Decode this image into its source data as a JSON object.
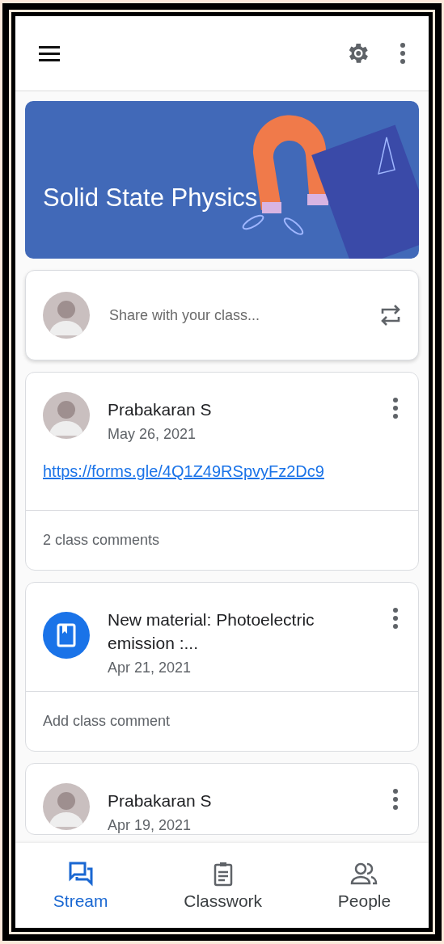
{
  "class_banner": {
    "title": "Solid State Physics"
  },
  "share_box": {
    "placeholder": "Share with your class..."
  },
  "posts": [
    {
      "kind": "announcement",
      "author": "Prabakaran S",
      "date": "May 26, 2021",
      "link": "https://forms.gle/4Q1Z49RSpvyFz2Dc9",
      "comments": "2 class comments"
    },
    {
      "kind": "material",
      "title": "New material: Photoelectric emission :...",
      "date": "Apr 21, 2021",
      "comments": "Add class comment"
    },
    {
      "kind": "announcement",
      "author": "Prabakaran S",
      "date": "Apr 19, 2021"
    }
  ],
  "bottom_nav": [
    {
      "label": "Stream",
      "selected": true
    },
    {
      "label": "Classwork",
      "selected": false
    },
    {
      "label": "People",
      "selected": false
    }
  ]
}
